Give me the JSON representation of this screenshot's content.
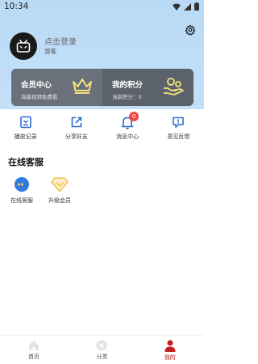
{
  "status_bar": {
    "time": "10:34"
  },
  "profile": {
    "login_text": "点击登录",
    "guest_text": "游客"
  },
  "cards": {
    "member": {
      "title": "会员中心",
      "subtitle": "海量视频免费看"
    },
    "points": {
      "title": "我的积分",
      "subtitle": "当前积分：",
      "value": "0"
    }
  },
  "quick_actions": [
    {
      "label": "播放记录",
      "icon": "history-icon"
    },
    {
      "label": "分享好友",
      "icon": "share-icon"
    },
    {
      "label": "消息中心",
      "icon": "bell-icon",
      "badge": "0"
    },
    {
      "label": "意见反馈",
      "icon": "feedback-icon"
    }
  ],
  "services": {
    "title": "在线客服",
    "items": [
      {
        "label": "在线客服",
        "icon": "chat-bubble-icon"
      },
      {
        "label": "升级会员",
        "icon": "diamond-icon"
      }
    ]
  },
  "tabbar": [
    {
      "label": "首页",
      "icon": "home-icon"
    },
    {
      "label": "分类",
      "icon": "category-icon"
    },
    {
      "label": "我的",
      "icon": "user-icon"
    }
  ],
  "colors": {
    "header_bg": "#b9daf6",
    "card_bg": "#6b717a",
    "accent": "#c21d1d",
    "icon_blue": "#2d6bd6",
    "badge": "#f04848",
    "crown": "#f5e27a",
    "diamond": "#f2c14e"
  }
}
